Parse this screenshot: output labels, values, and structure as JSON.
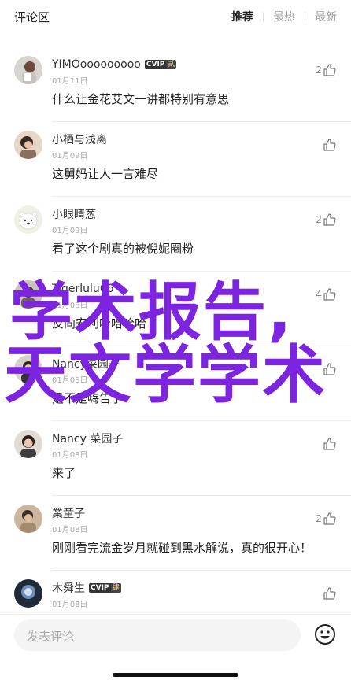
{
  "header": {
    "title": "评论区",
    "tabs": [
      {
        "label": "推荐",
        "active": true
      },
      {
        "label": "最热",
        "active": false
      },
      {
        "label": "最新",
        "active": false
      }
    ]
  },
  "comments": [
    {
      "name": "YIMOooooooooo",
      "vip": {
        "tag": "CVIP",
        "level": "贰"
      },
      "date": "01月11日",
      "text": "什么让金花艾文一讲都特别有意思",
      "likes": "2"
    },
    {
      "name": "小栖与浅离",
      "vip": null,
      "date": "01月09日",
      "text": "这舅妈让人一言难尽",
      "likes": ""
    },
    {
      "name": "小眼睛葱",
      "vip": null,
      "date": "01月09日",
      "text": "看了这个剧真的被倪妮圈粉",
      "likes": "2"
    },
    {
      "name": "Tigerlulu66",
      "vip": null,
      "date": "01月08日",
      "text": "反向安利哈哈哈哈",
      "likes": "4"
    },
    {
      "name": "Nancy菜园子",
      "vip": null,
      "date": "01月08日",
      "text": "是不是嗨告了",
      "likes": ""
    },
    {
      "name": "Nancy 菜园子",
      "vip": null,
      "date": "01月08日",
      "text": "来了",
      "likes": ""
    },
    {
      "name": "業童子",
      "vip": null,
      "date": "01月08日",
      "text": "刚刚看完流金岁月就碰到黑水解说，真的很开心！",
      "likes": "2"
    },
    {
      "name": "木舜生",
      "vip": {
        "tag": "CVIP",
        "level": "肆"
      },
      "date": "01月08日",
      "text": "",
      "likes": ""
    }
  ],
  "watermark": {
    "line1": "学术报告,",
    "line2": "天文学学术"
  },
  "input": {
    "placeholder": "发表评论"
  },
  "colors": {
    "watermark": "#7d24e0",
    "accent_text": "#222222",
    "secondary_text": "#aaaaaa"
  }
}
